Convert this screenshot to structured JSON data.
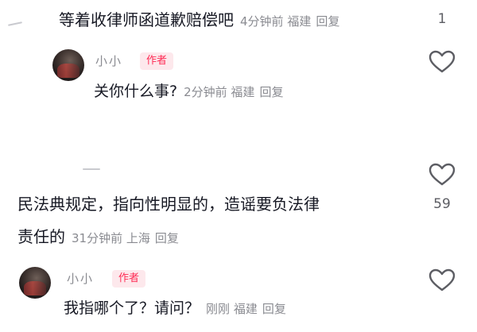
{
  "comments": [
    {
      "text": "等着收律师函道歉赔偿吧",
      "time": "4分钟前",
      "location": "福建",
      "reply_label": "回复",
      "likes": "1"
    },
    {
      "username": "小小",
      "badge": "作者",
      "text": "关你什么事?",
      "time": "2分钟前",
      "location": "福建",
      "reply_label": "回复"
    },
    {
      "text_line1": "民法典规定，指向性明显的，造谣要负法律",
      "text_line2": "责任的",
      "time": "31分钟前",
      "location": "上海",
      "reply_label": "回复",
      "likes": "59"
    },
    {
      "username": "小小",
      "badge": "作者",
      "text": "我指哪个了？请问？",
      "time": "刚刚",
      "location": "福建",
      "reply_label": "回复"
    }
  ],
  "icons": {
    "like": "heart-outline-icon"
  }
}
